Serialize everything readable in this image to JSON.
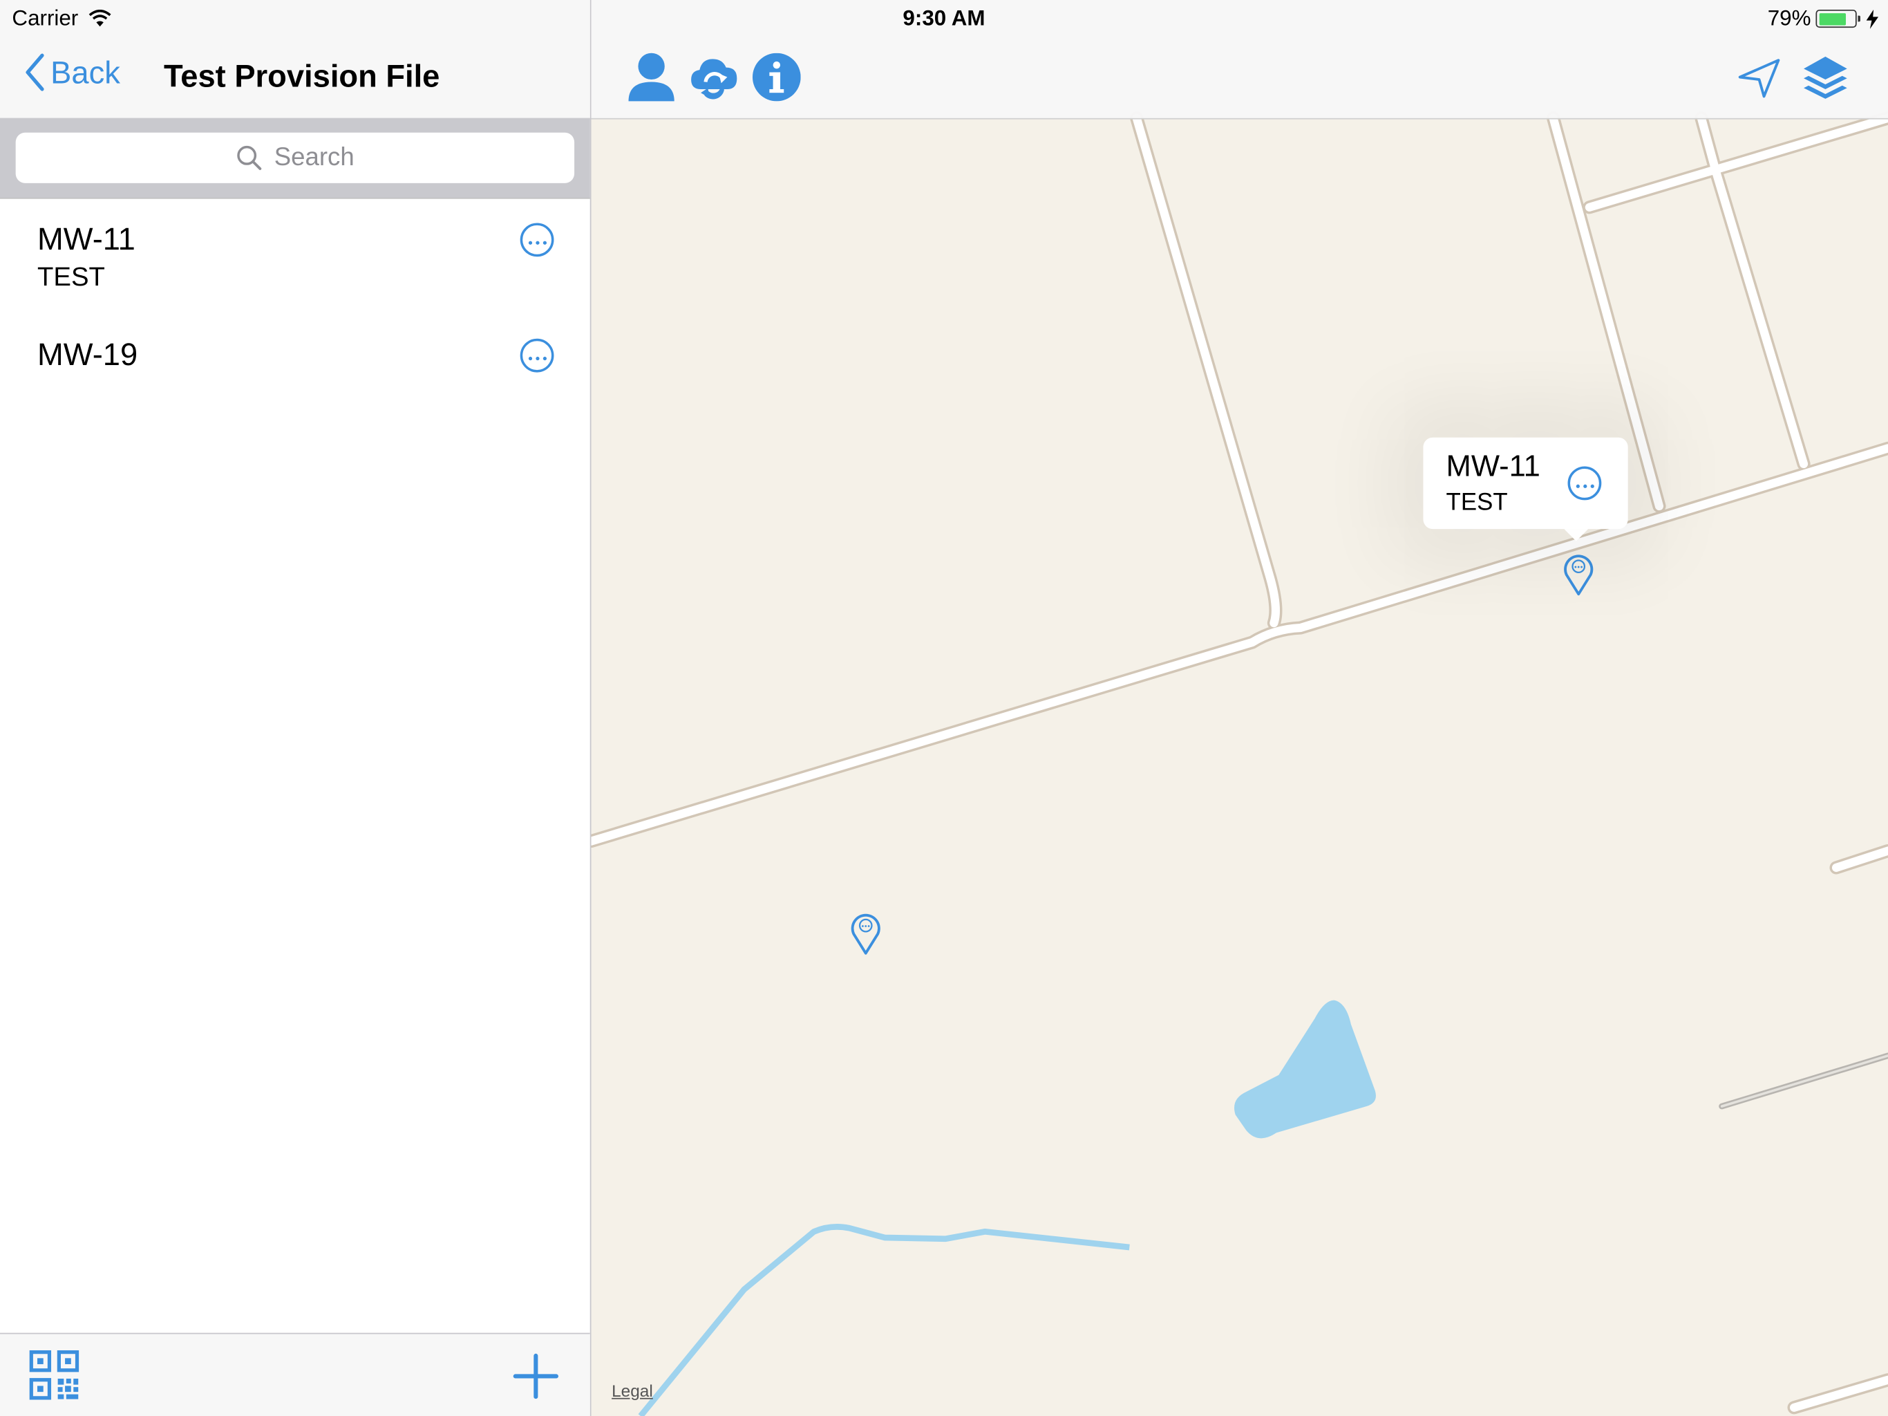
{
  "status_bar": {
    "carrier": "Carrier",
    "time": "9:30 AM",
    "battery_percent": "79%",
    "battery_level": 0.79
  },
  "sidebar": {
    "back_label": "Back",
    "title": "Test Provision File",
    "search_placeholder": "Search",
    "items": [
      {
        "title": "MW-11",
        "subtitle": "TEST"
      },
      {
        "title": "MW-19",
        "subtitle": ""
      }
    ]
  },
  "map": {
    "callout": {
      "title": "MW-11",
      "subtitle": "TEST"
    },
    "legal_label": "Legal",
    "toolbar_icons": [
      "user-icon",
      "cloud-sync-icon",
      "info-icon",
      "location-arrow-icon",
      "layers-icon"
    ]
  },
  "colors": {
    "accent": "#3b8fde",
    "map_land": "#f5f1e8",
    "map_water": "#9fd3ee",
    "road_fill": "#ffffff",
    "road_edge": "#d2c6b6",
    "battery": "#4cd964"
  }
}
